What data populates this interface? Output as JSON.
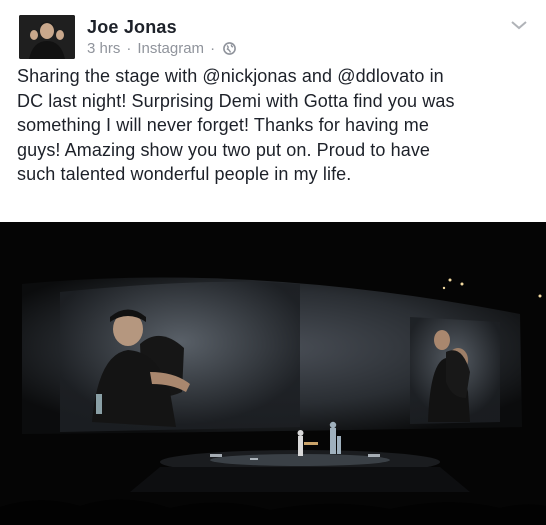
{
  "post": {
    "author": "Joe Jonas",
    "time": "3 hrs",
    "source": "Instagram",
    "separator": "·",
    "text_lines": [
      "Sharing the stage with @nickjonas and @ddlovato in",
      "DC last night! Surprising Demi with Gotta find you was",
      "something I will never forget! Thanks for having me",
      "guys! Amazing show you two put on. Proud to have",
      "such talented wonderful people in my life."
    ]
  },
  "icons": {
    "avatar": "profile-photo",
    "audience": "globe-icon",
    "menu": "chevron-down-icon"
  },
  "colors": {
    "text": "#1d2129",
    "meta": "#90949c",
    "photo_bg": "#000000"
  }
}
